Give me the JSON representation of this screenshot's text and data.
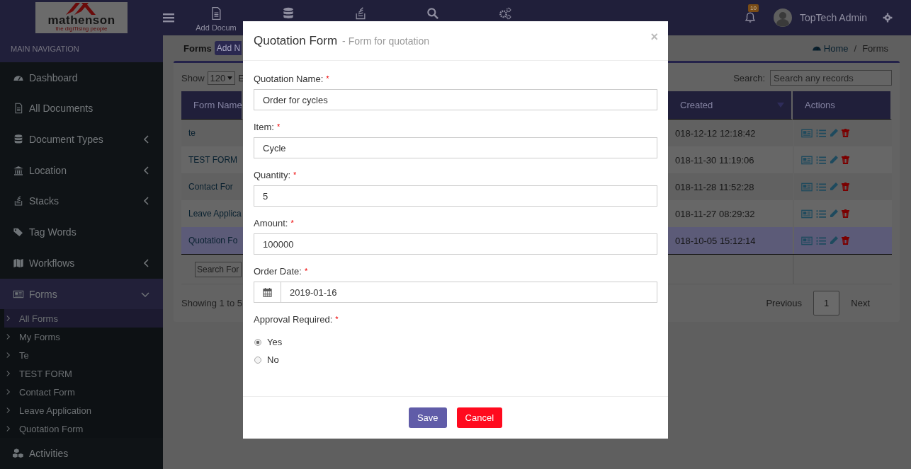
{
  "header": {
    "logo": {
      "name": "mathenson",
      "tagline": "the digiTising people"
    },
    "nav_label": "Add Docum",
    "notifications": {
      "count": "10"
    },
    "user": "TopTech Admin"
  },
  "sidebar": {
    "heading": "MAIN NAVIGATION",
    "items": [
      {
        "label": "Dashboard",
        "has_submenu": false,
        "expanded": false
      },
      {
        "label": "All Documents",
        "has_submenu": false,
        "expanded": false
      },
      {
        "label": "Document Types",
        "has_submenu": true,
        "expanded": false
      },
      {
        "label": "Location",
        "has_submenu": true,
        "expanded": false
      },
      {
        "label": "Stacks",
        "has_submenu": true,
        "expanded": false
      },
      {
        "label": "Tag Words",
        "has_submenu": false,
        "expanded": false
      },
      {
        "label": "Workflows",
        "has_submenu": true,
        "expanded": false
      },
      {
        "label": "Forms",
        "has_submenu": true,
        "expanded": true,
        "children": [
          {
            "label": "All Forms",
            "selected": true
          },
          {
            "label": "My Forms",
            "selected": false
          },
          {
            "label": "Te",
            "selected": false
          },
          {
            "label": "TEST FORM",
            "selected": false
          },
          {
            "label": "Contact Form",
            "selected": false
          },
          {
            "label": "Leave Application",
            "selected": false
          },
          {
            "label": "Quotation Form",
            "selected": false
          }
        ]
      },
      {
        "label": "Activities",
        "has_submenu": false,
        "expanded": false
      }
    ]
  },
  "main": {
    "title": "Forms",
    "add_button": "Add N",
    "breadcrumb": {
      "separator": "/",
      "items": [
        {
          "label": "Home"
        },
        {
          "label": "Forms"
        }
      ]
    },
    "controls": {
      "show_label": "Show",
      "page_size": "120",
      "entries_label": "E",
      "search_label": "Search:",
      "search_placeholder": "Search any records"
    },
    "table": {
      "columns": [
        {
          "label": "Form Name",
          "sorted": false
        },
        {
          "label": "Created",
          "sorted": true
        },
        {
          "label": "Actions",
          "sorted": false
        }
      ],
      "rows": [
        {
          "name": "te",
          "created": "018-12-12 12:18:42",
          "selected": false
        },
        {
          "name": "TEST FORM",
          "created": "018-11-30 11:19:06",
          "selected": false
        },
        {
          "name": "Contact For",
          "created": "018-11-28 11:52:28",
          "selected": false
        },
        {
          "name": "Leave Applica",
          "created": "018-11-27 08:29:32",
          "selected": false
        },
        {
          "name": "Quotation Fo",
          "created": "018-10-05 15:12:14",
          "selected": true
        }
      ],
      "filter_placeholder": "Search For"
    },
    "info": "Showing 1 to 5",
    "pagination": {
      "previous": "Previous",
      "pages": [
        {
          "label": "1",
          "selected": true
        }
      ],
      "next": "Next"
    }
  },
  "modal": {
    "title": "Quotation Form",
    "subtitle": "- Form for quotation",
    "close": "×",
    "fields": [
      {
        "kind": "text",
        "label": "Quotation Name:",
        "marker": "*",
        "value": "Order for cycles"
      },
      {
        "kind": "text",
        "label": "Item:",
        "marker": "*",
        "value": "Cycle"
      },
      {
        "kind": "text",
        "label": "Quantity:",
        "marker": "*",
        "value": "5"
      },
      {
        "kind": "text",
        "label": "Amount:",
        "marker": "*",
        "value": "100000"
      },
      {
        "kind": "date",
        "label": "Order Date:",
        "marker": "*",
        "value": "2019-01-16"
      },
      {
        "kind": "radio",
        "label": "Approval Required:",
        "marker": "*",
        "options": [
          {
            "label": "Yes",
            "selected": true
          },
          {
            "label": "No",
            "selected": false
          }
        ]
      }
    ],
    "buttons": [
      {
        "kind": "primary",
        "label": "Save"
      },
      {
        "kind": "danger",
        "label": "Cancel"
      }
    ]
  }
}
